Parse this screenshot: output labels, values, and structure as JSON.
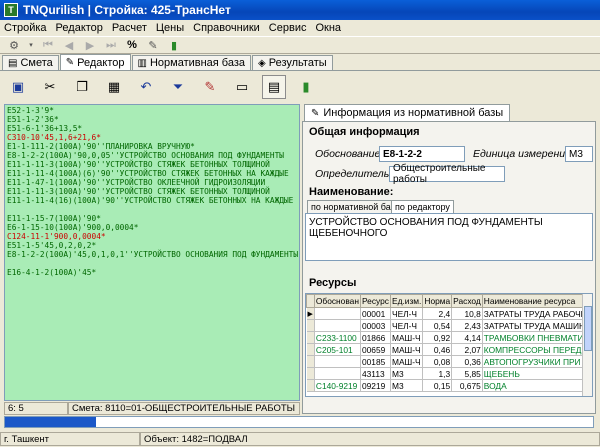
{
  "window": {
    "title": "TNQurilish  |  Стройка: 425-ТрансНет"
  },
  "menu": [
    "Стройка",
    "Редактор",
    "Расчет",
    "Цены",
    "Справочники",
    "Сервис",
    "Окна"
  ],
  "tabs": [
    {
      "label": "Смета",
      "icon": "smeta-icon"
    },
    {
      "label": "Редактор",
      "icon": "editor-icon",
      "active": true
    },
    {
      "label": "Нормативная база",
      "icon": "book-icon"
    },
    {
      "label": "Результаты",
      "icon": "results-icon"
    }
  ],
  "editor": {
    "lines": [
      {
        "text": "E52-1-3'9*",
        "color": "green"
      },
      {
        "text": "E51-1-2'36*",
        "color": "green"
      },
      {
        "text": "E51-6-1'36+13,5*",
        "color": "green"
      },
      {
        "text": "C310-10'45,1,6+21,6*",
        "color": "red"
      },
      {
        "text": "E1-1-111-2(100A)'90''ПЛАНИРОВКА ВРУЧНУЮ*",
        "color": "green"
      },
      {
        "text": "E8-1-2-2(100A)'90,0,05''УСТРОЙСТВО ОСНОВАНИЯ ПОД ФУНДАМЕНТЫ",
        "color": "green"
      },
      {
        "text": "E11-1-11-3(100A)'90''УСТРОЙСТВО СТЯЖЕК БЕТОННЫХ ТОЛЩИНОЙ",
        "color": "green"
      },
      {
        "text": "E11-1-11-4(100A)(6)'90''УСТРОЙСТВО СТЯЖЕК БЕТОННЫХ НА КАЖДЫЕ",
        "color": "green"
      },
      {
        "text": "E11-1-47-1(100A)'90''УСТРОЙСТВО ОКЛЕЕЧНОЙ ГИДРОИЗОЛЯЦИИ",
        "color": "green"
      },
      {
        "text": "E11-1-11-3(100A)'90''УСТРОЙСТВО СТЯЖЕК БЕТОННЫХ ТОЛЩИНОЙ",
        "color": "green"
      },
      {
        "text": "E11-1-11-4(16)(100A)'90''УСТРОЙСТВО СТЯЖЕК БЕТОННЫХ НА КАЖДЫЕ",
        "color": "green"
      },
      {
        "text": "",
        "color": "green"
      },
      {
        "text": "E11-1-15-7(100A)'90*",
        "color": "green"
      },
      {
        "text": "E6-1-15-10(100A)'900,0,0004*",
        "color": "green"
      },
      {
        "text": "C124-11-1'900,0,0004*",
        "color": "red"
      },
      {
        "text": "E51-1-5'45,0,2,0,2*",
        "color": "green"
      },
      {
        "text": "E8-1-2-2(100A)'45,0,1,0,1''УСТРОЙСТВО ОСНОВАНИЯ ПОД ФУНДАМЕНТЫ",
        "color": "green"
      },
      {
        "text": "",
        "color": "green"
      },
      {
        "text": "E16-4-1-2(100A)'45*",
        "color": "green"
      }
    ]
  },
  "status": {
    "cursor": "6: 5",
    "smeta": "Смета: 8110=01-ОБЩЕСТРОИТЕЛЬНЫЕ РАБОТЫ",
    "city": "г. Ташкент",
    "object": "Объект: 1482=ПОДВАЛ",
    "progress": 0.155
  },
  "info_panel": {
    "tab_label": "Информация из нормативной базы",
    "general_title": "Общая информация",
    "code_label": "Обоснование:",
    "code_value": "E8-1-2-2",
    "unit_label": "Единица измерения:",
    "unit_value": "M3",
    "determinant_label": "Определитель:",
    "determinant_value": "Общестроительные работы",
    "name_title": "Наименование:",
    "subtab_base": "по нормативной базе",
    "subtab_editor": "по редактору",
    "name_value": "УСТРОЙСТВО ОСНОВАНИЯ ПОД ФУНДАМЕНТЫ ЩЕБЕНОЧНОГО",
    "resources_title": "Ресурсы"
  },
  "resources": {
    "columns": [
      "Обоснован",
      "Ресурс",
      "Ед.изм.",
      "Норма",
      "Расход",
      "Наименование ресурса"
    ],
    "rows": [
      {
        "code": "",
        "res": "00001",
        "unit": "ЧЕЛ-Ч",
        "norm": "2,4",
        "rate": "10,8",
        "name": "ЗАТРАТЫ ТРУДА РАБОЧИХ-",
        "green": false,
        "current": true
      },
      {
        "code": "",
        "res": "00003",
        "unit": "ЧЕЛ-Ч",
        "norm": "0,54",
        "rate": "2,43",
        "name": "ЗАТРАТЫ ТРУДА МАШИНИСТ",
        "green": false
      },
      {
        "code": "C233-1100",
        "res": "01866",
        "unit": "МАШ-Ч",
        "norm": "0,92",
        "rate": "4,14",
        "name": "ТРАМБОВКИ ПНЕВМАТИЧЕС",
        "green": true
      },
      {
        "code": "C205-101",
        "res": "00659",
        "unit": "МАШ-Ч",
        "norm": "0,46",
        "rate": "2,07",
        "name": "КОМПРЕССОРЫ ПЕРЕДВИЖ",
        "green": true
      },
      {
        "code": "",
        "res": "00185",
        "unit": "МАШ-Ч",
        "norm": "0,08",
        "rate": "0,36",
        "name": "АВТОПОГРУЗЧИКИ ПРИ РАБ",
        "green": true
      },
      {
        "code": "",
        "res": "43113",
        "unit": "M3",
        "norm": "1,3",
        "rate": "5,85",
        "name": "ЩЕБЕНЬ",
        "green": true
      },
      {
        "code": "C140-9219",
        "res": "09219",
        "unit": "M3",
        "norm": "0,15",
        "rate": "0,675",
        "name": "ВОДА",
        "green": true
      }
    ]
  }
}
